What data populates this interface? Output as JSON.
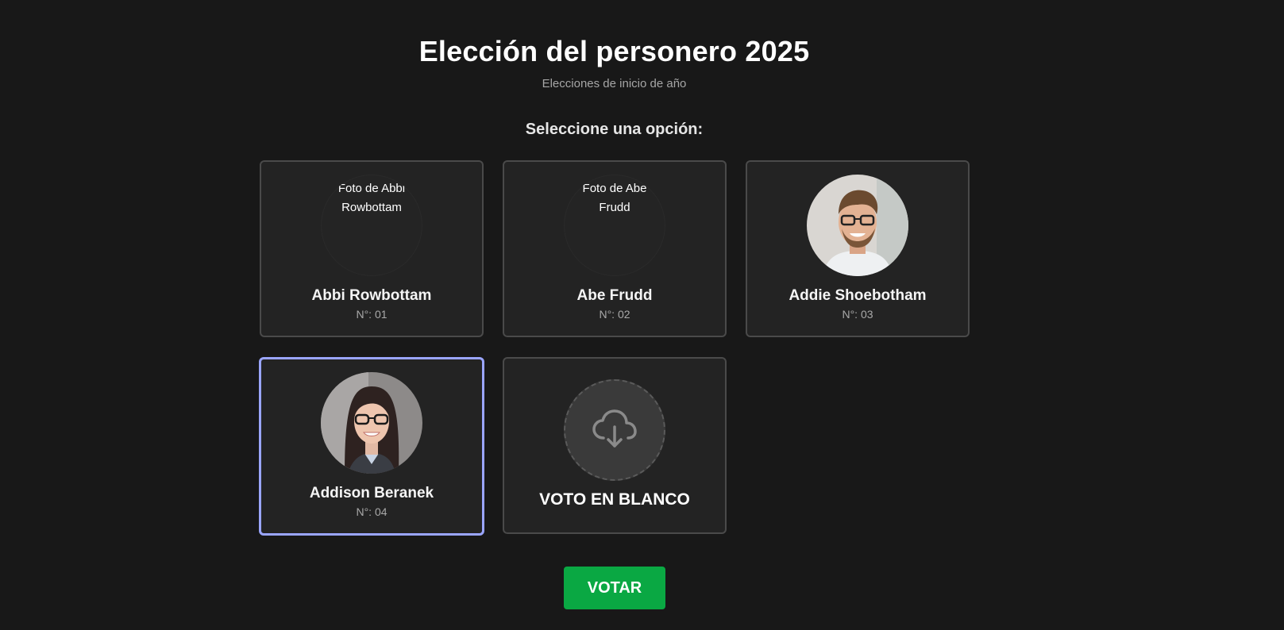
{
  "header": {
    "title": "Elección del personero 2025",
    "subtitle": "Elecciones de inicio de año",
    "prompt": "Seleccione una opción:"
  },
  "candidates": [
    {
      "name": "Abbi Rowbottam",
      "number": "N°: 01",
      "photo_alt_line1": "Foto de Abbi",
      "photo_alt_line2": "Rowbottam",
      "photo_status": "broken"
    },
    {
      "name": "Abe Frudd",
      "number": "N°: 02",
      "photo_alt_line1": "Foto de Abe",
      "photo_alt_line2": "Frudd",
      "photo_status": "broken"
    },
    {
      "name": "Addie Shoebotham",
      "number": "N°: 03",
      "photo_status": "loaded",
      "photo_icon": "man-with-glasses-portrait"
    },
    {
      "name": "Addison Beranek",
      "number": "N°: 04",
      "photo_status": "loaded",
      "photo_icon": "woman-with-glasses-portrait",
      "selected": true
    }
  ],
  "blank_vote": {
    "label": "VOTO EN BLANCO",
    "icon": "cloud-download-icon"
  },
  "vote_button": {
    "label": "VOTAR",
    "color": "#0aa843"
  },
  "colors": {
    "background": "#181818",
    "card": "#232323",
    "card_border": "#4a4a4a",
    "selected_border": "#9aa5ff"
  }
}
